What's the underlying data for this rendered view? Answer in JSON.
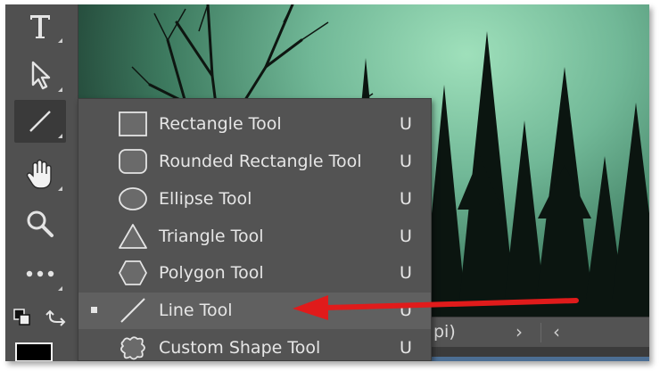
{
  "toolbar": {
    "tools": [
      {
        "name": "type-tool",
        "icon": "type-icon"
      },
      {
        "name": "path-selection-tool",
        "icon": "arrow-cursor-icon"
      },
      {
        "name": "line-tool",
        "icon": "line-icon",
        "active": true
      },
      {
        "name": "hand-tool",
        "icon": "hand-icon"
      },
      {
        "name": "zoom-tool",
        "icon": "magnifier-icon"
      },
      {
        "name": "more-tools",
        "icon": "ellipsis-icon"
      }
    ]
  },
  "flyout": {
    "items": [
      {
        "label": "Rectangle Tool",
        "shortcut": "U",
        "icon": "rectangle-icon"
      },
      {
        "label": "Rounded Rectangle Tool",
        "shortcut": "U",
        "icon": "rounded-rectangle-icon"
      },
      {
        "label": "Ellipse Tool",
        "shortcut": "U",
        "icon": "ellipse-icon"
      },
      {
        "label": "Triangle Tool",
        "shortcut": "U",
        "icon": "triangle-icon"
      },
      {
        "label": "Polygon Tool",
        "shortcut": "U",
        "icon": "polygon-icon"
      },
      {
        "label": "Line Tool",
        "shortcut": "U",
        "icon": "line-icon",
        "selected": true
      },
      {
        "label": "Custom Shape Tool",
        "shortcut": "U",
        "icon": "custom-shape-icon"
      }
    ]
  },
  "status_bar": {
    "text": "pi)",
    "next": "›",
    "prev": "‹"
  },
  "annotation": {
    "color": "#e01b1b",
    "icon": "red-arrow"
  }
}
